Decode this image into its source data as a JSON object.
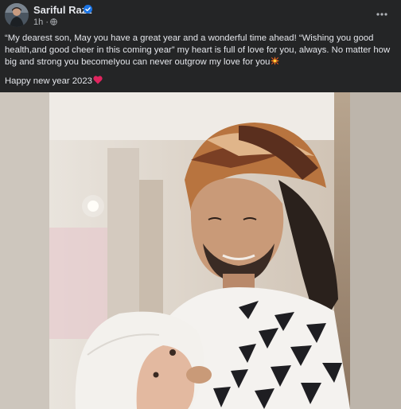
{
  "post": {
    "author": "Sariful Razz",
    "verified": true,
    "time": "1h",
    "separator": "·",
    "privacy_icon": "globe-icon",
    "more_icon": "more-options-icon",
    "caption_line1": "“My dearest son, May you have a great year and a wonderful time ahead! “Wishing you good health,and good cheer in this coming year”  my heart is full of love for you, always. No matter how big and strong you becomeIyou can never outgrow my love for you",
    "caption_line2": "Happy new year 2023",
    "emoji1": "sparkle-emoji",
    "emoji2": "red-heart-emoji"
  },
  "photo": {
    "subject": "man-holding-baby-photo"
  },
  "colors": {
    "background": "#242526",
    "text_primary": "#e4e6eb",
    "text_secondary": "#b0b3b8",
    "verified_blue": "#1b74e4",
    "heart_red": "#e0245e"
  }
}
